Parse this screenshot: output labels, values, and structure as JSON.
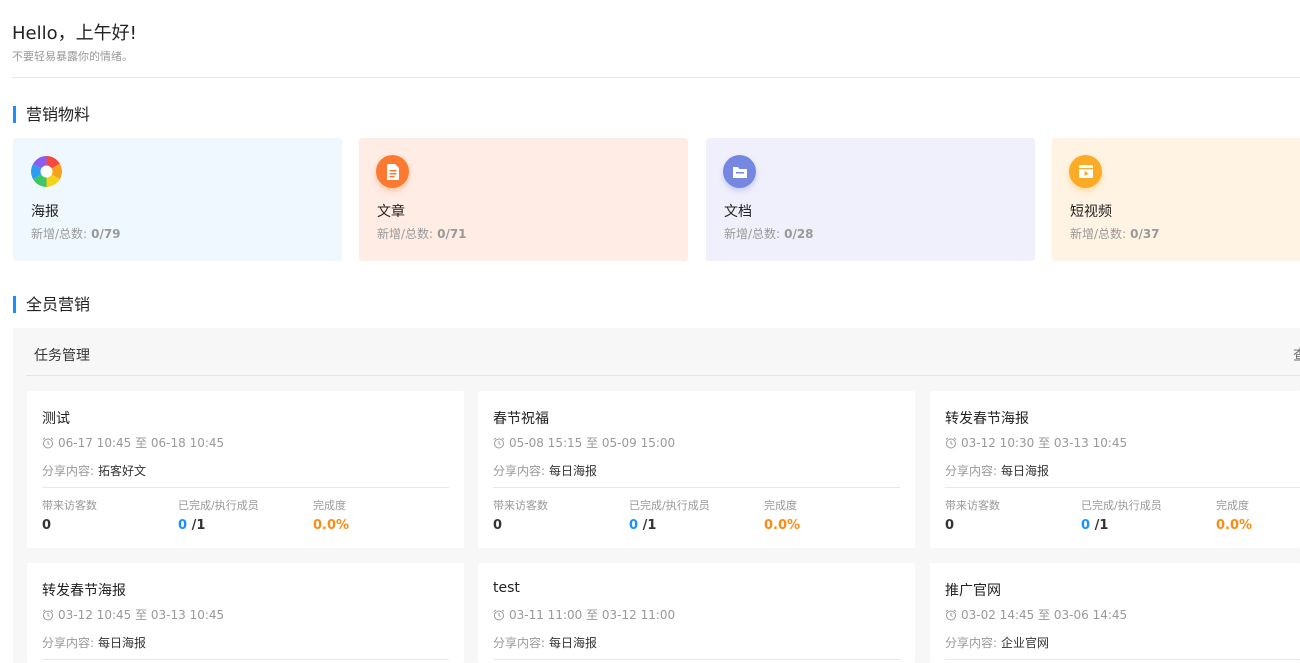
{
  "header": {
    "greeting": "Hello，上午好!",
    "subtitle": "不要轻易暴露你的情绪。"
  },
  "materials": {
    "title": "营销物料",
    "stat_label": "新增/总数:",
    "items": [
      {
        "name": "海报",
        "stat": "0/79",
        "bg": "#eff8ff",
        "icon": "aperture-icon"
      },
      {
        "name": "文章",
        "stat": "0/71",
        "bg": "#ffece5",
        "icon": "document-icon"
      },
      {
        "name": "文档",
        "stat": "0/28",
        "bg": "#f0f0fc",
        "icon": "folder-icon"
      },
      {
        "name": "短视频",
        "stat": "0/37",
        "bg": "#fff3e3",
        "icon": "video-icon"
      }
    ]
  },
  "marketing": {
    "title": "全员营销",
    "panel_title": "任务管理",
    "more_label": "查",
    "share_label": "分享内容:",
    "visitors_label": "带来访客数",
    "members_label": "已完成/执行成员",
    "completion_label": "完成度",
    "tasks": [
      {
        "title": "测试",
        "time": "06-17 10:45 至 06-18 10:45",
        "share": "拓客好文",
        "visitors": "0",
        "done": "0",
        "total": "/1",
        "completion": "0.0%"
      },
      {
        "title": "春节祝福",
        "time": "05-08 15:15 至 05-09 15:00",
        "share": "每日海报",
        "visitors": "0",
        "done": "0",
        "total": "/1",
        "completion": "0.0%"
      },
      {
        "title": "转发春节海报",
        "time": "03-12 10:30 至 03-13 10:45",
        "share": "每日海报",
        "visitors": "0",
        "done": "0",
        "total": "/1",
        "completion": "0.0%"
      },
      {
        "title": "转发春节海报",
        "time": "03-12 10:45 至 03-13 10:45",
        "share": "每日海报"
      },
      {
        "title": "test",
        "time": "03-11 11:00 至 03-12 11:00",
        "share": "每日海报"
      },
      {
        "title": "推广官网",
        "time": "03-02 14:45 至 03-06 14:45",
        "share": "企业官网"
      }
    ]
  }
}
